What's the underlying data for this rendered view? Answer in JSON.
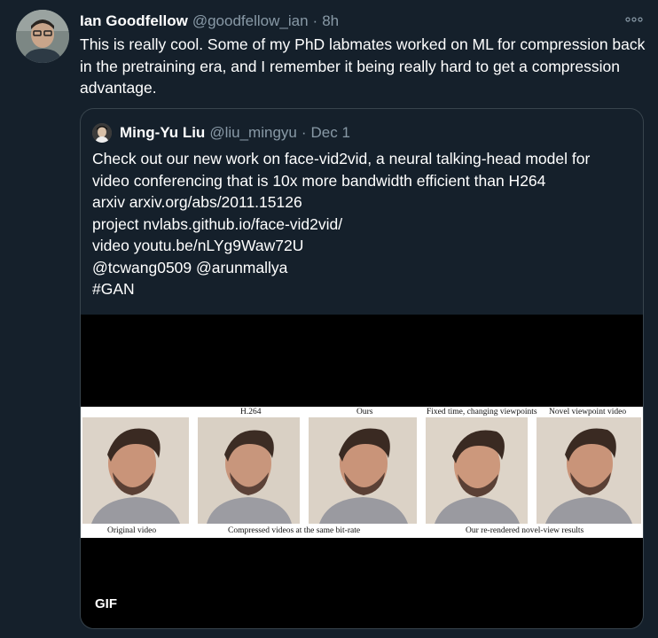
{
  "tweet": {
    "author_name": "Ian Goodfellow",
    "author_handle": "@goodfellow_ian",
    "separator": "·",
    "time": "8h",
    "more_label": "ooo",
    "text": "This is really cool. Some of my PhD labmates worked on ML for compression back in the pretraining era, and I remember it being really hard to get a compression advantage."
  },
  "quoted": {
    "author_name": "Ming-Yu Liu",
    "author_handle": "@liu_mingyu",
    "separator": "·",
    "time": "Dec 1",
    "lines": [
      "Check out our new work on face-vid2vid, a neural talking-head model for",
      "video conferencing that is 10x more bandwidth efficient than H264",
      "arxiv arxiv.org/abs/2011.15126",
      "project nvlabs.github.io/face-vid2vid/",
      "video youtu.be/nLYg9Waw72U",
      "@tcwang0509 @arunmallya",
      "#GAN"
    ],
    "media": {
      "badge": "GIF",
      "top_captions": [
        "H.264",
        "Ours",
        "Fixed time, changing viewpoints",
        "Novel viewpoint video"
      ],
      "bottom_captions": [
        "Original video",
        "Compressed videos at the same bit-rate",
        "Our re-rendered novel-view results"
      ]
    }
  },
  "colors": {
    "background": "#15202b",
    "secondary_text": "#8899a6",
    "border": "#38444d"
  }
}
